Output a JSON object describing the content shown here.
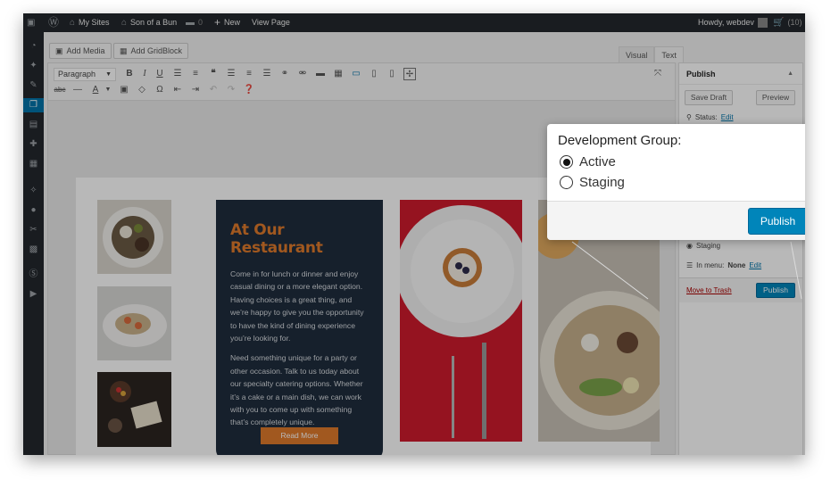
{
  "adminbar": {
    "my_sites": "My Sites",
    "site_name": "Son of a Bun",
    "comments": "0",
    "new": "New",
    "view_page": "View Page",
    "howdy": "Howdy, webdev",
    "cart": "(10)"
  },
  "editor": {
    "add_media": "Add Media",
    "add_gridblock": "Add GridBlock",
    "tab_visual": "Visual",
    "tab_text": "Text",
    "format_select": "Paragraph"
  },
  "gridblock": {
    "heading": "At Our Restaurant",
    "para1": "Come in for lunch or dinner and enjoy casual dining or a more elegant option. Having choices is a great thing, and we’re happy to give you the opportunity to have the kind of dining experience you’re looking for.",
    "para2": "Need something unique for a party or other occasion. Talk to us today about our specialty catering options. Whether it’s a cake or a main dish, we can work with you to come up with something that’s completely unique.",
    "read_more": "Read More",
    "accent_color": "#e07a2c",
    "card_color": "#1f2d3d"
  },
  "publish_box": {
    "title": "Publish",
    "save_draft": "Save Draft",
    "preview": "Preview",
    "status_label": "Status:",
    "status_edit": "Edit",
    "staging": "Staging",
    "in_menu_label": "In menu:",
    "in_menu_value": "None",
    "in_menu_edit": "Edit",
    "move_to_trash": "Move to Trash",
    "publish": "Publish"
  },
  "popup": {
    "title": "Development Group:",
    "options": [
      {
        "label": "Active",
        "checked": true
      },
      {
        "label": "Staging",
        "checked": false
      }
    ],
    "publish": "Publish",
    "button_color": "#0085ba"
  }
}
